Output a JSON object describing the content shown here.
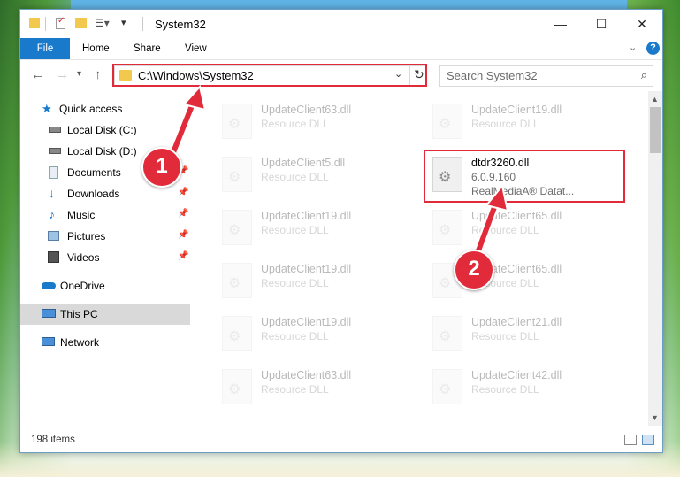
{
  "window": {
    "title": "System32",
    "controls": {
      "minimize": "—",
      "maximize": "☐",
      "close": "✕"
    }
  },
  "ribbon": {
    "tabs": [
      "File",
      "Home",
      "Share",
      "View"
    ],
    "help_label": "?",
    "collapse_label": "⌄"
  },
  "address": {
    "path": "C:\\Windows\\System32",
    "search_placeholder": "Search System32"
  },
  "sidebar": {
    "items": [
      {
        "label": "Quick access",
        "icon": "star-icon"
      },
      {
        "label": "Local Disk (C:)",
        "icon": "drive-icon"
      },
      {
        "label": "Local Disk (D:)",
        "icon": "drive-icon"
      },
      {
        "label": "Documents",
        "icon": "documents-icon"
      },
      {
        "label": "Downloads",
        "icon": "download-icon"
      },
      {
        "label": "Music",
        "icon": "music-icon"
      },
      {
        "label": "Pictures",
        "icon": "pictures-icon"
      },
      {
        "label": "Videos",
        "icon": "videos-icon"
      },
      {
        "label": "OneDrive",
        "icon": "cloud-icon"
      },
      {
        "label": "This PC",
        "icon": "computer-icon"
      },
      {
        "label": "Network",
        "icon": "network-icon"
      }
    ]
  },
  "files": [
    {
      "name": "UpdateClient63.dll",
      "type": "Resource DLL"
    },
    {
      "name": "UpdateClient19.dll",
      "type": "Resource DLL"
    },
    {
      "name": "UpdateClient5.dll",
      "type": "Resource DLL"
    },
    {
      "name": "dtdr3260.dll",
      "version": "6.0.9.160",
      "description": "RealMediaA® Datat..."
    },
    {
      "name": "UpdateClient19.dll",
      "type": "Resource DLL"
    },
    {
      "name": "UpdateClient65.dll",
      "type": "Resource DLL"
    },
    {
      "name": "UpdateClient19.dll",
      "type": "Resource DLL"
    },
    {
      "name": "UpdateClient65.dll",
      "type": "Resource DLL"
    },
    {
      "name": "UpdateClient19.dll",
      "type": "Resource DLL"
    },
    {
      "name": "UpdateClient21.dll",
      "type": "Resource DLL"
    },
    {
      "name": "UpdateClient63.dll",
      "type": "Resource DLL"
    },
    {
      "name": "UpdateClient42.dll",
      "type": "Resource DLL"
    }
  ],
  "status": {
    "item_count": "198 items"
  },
  "callouts": {
    "one": "1",
    "two": "2"
  },
  "colors": {
    "accent": "#1979ca",
    "highlight_red": "#e12b3a",
    "selected_bg": "#d9d9d9"
  }
}
